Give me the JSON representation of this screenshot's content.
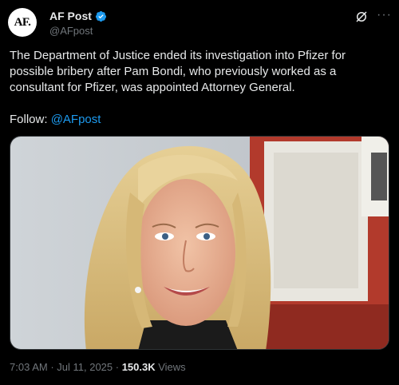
{
  "author": {
    "avatar_text": "AF.",
    "display_name": "AF Post",
    "handle": "@AFpost",
    "verified_icon": "verified-badge-icon"
  },
  "post": {
    "text": "The Department of Justice ended its investigation into Pfizer for possible bribery after Pam Bondi, who previously worked as a consultant for Pfizer, was appointed Attorney General.",
    "follow_prefix": "Follow: ",
    "follow_link": "@AFpost"
  },
  "meta": {
    "time": "7:03 AM",
    "separator1": " · ",
    "date": "Jul 11, 2025",
    "separator2": " · ",
    "views_count": "150.3K",
    "views_label": " Views"
  },
  "colors": {
    "background": "#000000",
    "text": "#e7e9ea",
    "muted": "#71767b",
    "link": "#1d9bf0"
  }
}
